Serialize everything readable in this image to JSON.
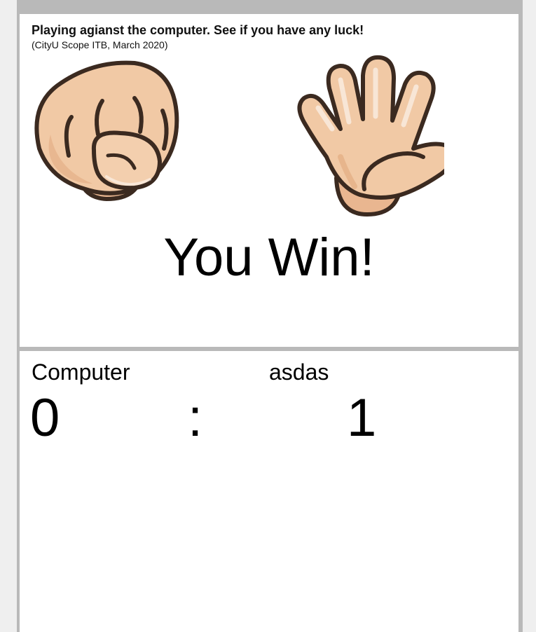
{
  "header": {
    "title": "Playing agianst the computer. See if you have any luck!",
    "subtitle": "(CityU Scope ITB, March 2020)"
  },
  "hands": {
    "left": {
      "icon": "fist-rock-hand-icon",
      "move": "rock"
    },
    "right": {
      "icon": "open-paper-hand-icon",
      "move": "paper"
    }
  },
  "result": {
    "text": "You Win!"
  },
  "scoreboard": {
    "computer_label": "Computer",
    "player_label": "asdas",
    "computer_score": "0",
    "separator": ":",
    "player_score": "1"
  },
  "colors": {
    "skin": "#f1c9a5",
    "skin_shade": "#e2ac82",
    "outline": "#3b2a20",
    "frame": "#b9b9b9",
    "page_bg": "#efefef"
  }
}
